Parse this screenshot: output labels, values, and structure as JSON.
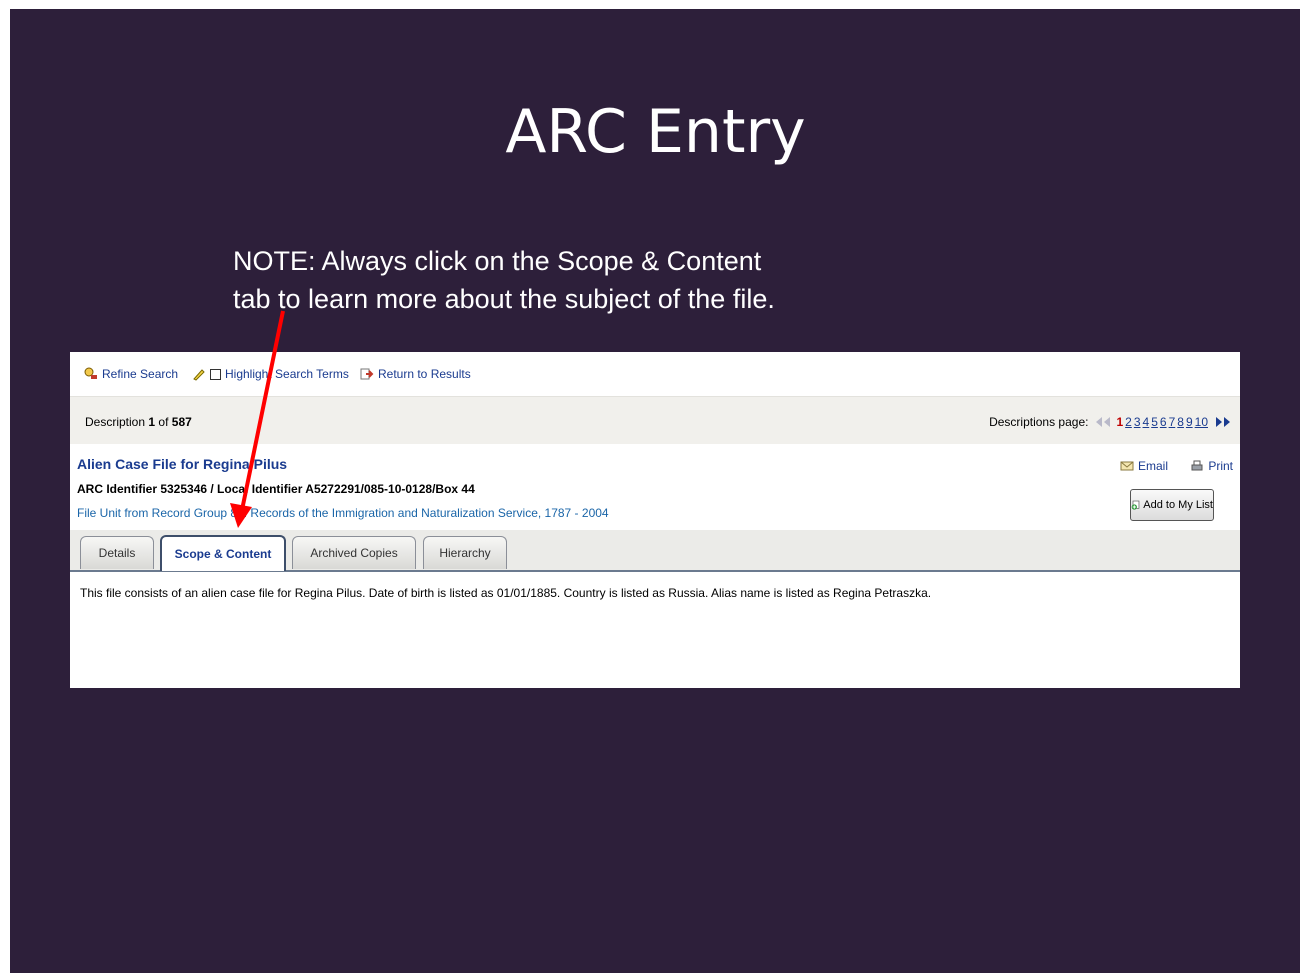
{
  "slide": {
    "title": "ARC Entry",
    "note_line1": "NOTE:  Always click on the Scope & Content",
    "note_line2": "tab to learn more about the subject of the file."
  },
  "toolbar": {
    "refine": "Refine Search",
    "highlight": "Highlight Search Terms",
    "return": "Return to Results"
  },
  "description": {
    "prefix": "Description",
    "current": "1",
    "of": "of",
    "total": "587",
    "pager_label": "Descriptions page:",
    "pages": [
      "1",
      "2",
      "3",
      "4",
      "5",
      "6",
      "7",
      "8",
      "9",
      "10"
    ],
    "current_page": "1"
  },
  "record": {
    "title": "Alien Case File for Regina Pilus",
    "identifiers": "ARC Identifier 5325346 / Local Identifier A5272291/085-10-0128/Box 44",
    "group": "File Unit from Record Group 85: Records of the Immigration and Naturalization Service, 1787 - 2004",
    "email": "Email",
    "print": "Print",
    "add_to_list": "Add to My List"
  },
  "tabs": [
    "Details",
    "Scope & Content",
    "Archived Copies",
    "Hierarchy"
  ],
  "active_tab": "Scope & Content",
  "content": {
    "text": "This file consists of an alien case file for Regina Pilus.  Date of birth is listed as 01/01/1885.  Country is listed as Russia.    Alias name is listed as Regina Petraszka."
  },
  "colors": {
    "slide_bg": "#2d1f3a",
    "link": "#1a3b8f",
    "annotation_arrow": "#ff0000"
  }
}
